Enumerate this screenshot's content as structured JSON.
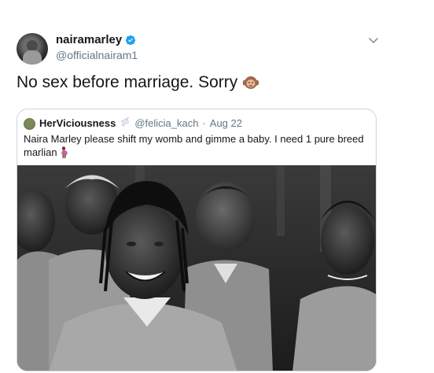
{
  "tweet": {
    "display_name": "nairamarley",
    "handle": "@officialnairam1",
    "text": "No sex before marriage. Sorry",
    "emoji": "hear-no-evil-monkey-emoji"
  },
  "quoted": {
    "display_name": "HerViciousness",
    "handle": "@felicia_kach",
    "separator": "·",
    "date": "Aug 22",
    "text": "Naira Marley please shift my womb and gimme a baby. I need 1 pure breed marlian",
    "photo": "grayscale photo of smiling young men in prison uniforms"
  },
  "colors": {
    "text": "#14171a",
    "secondary": "#657786",
    "verified": "#1da1f2",
    "border": "#ccd6dd"
  },
  "icons": {
    "verified": "verified-badge-icon",
    "menu": "chevron-down-icon",
    "unicorn": "unicorn-emoji",
    "pregnant": "pregnant-woman-emoji"
  }
}
